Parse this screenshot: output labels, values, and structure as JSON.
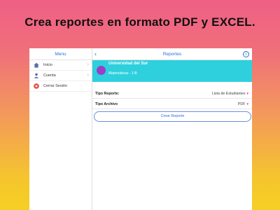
{
  "promo": {
    "title": "Crea reportes en formato PDF y EXCEL."
  },
  "sidebar": {
    "title": "Menu",
    "items": [
      {
        "label": "Inicio",
        "icon": "home-icon"
      },
      {
        "label": "Cuenta",
        "icon": "user-icon"
      },
      {
        "label": "Cerrar Sesión",
        "icon": "logout-icon"
      }
    ]
  },
  "header": {
    "title": "Reportes",
    "back_icon": "chevron-left-icon",
    "info_icon": "info-icon"
  },
  "banner": {
    "university": "Universidad del Sur",
    "course": "Matemáticas - 1-B"
  },
  "form": {
    "report_type_label": "Tipo Reporte:",
    "report_type_value": "Lista de Estudiantes",
    "file_type_label": "Tipo Archivo",
    "file_type_value": "PDF",
    "create_button": "Crear Reporte"
  },
  "colors": {
    "accent": "#2a6fd6",
    "banner": "#2fd0de",
    "dot": "#9a3fc6",
    "logout": "#e0453a"
  }
}
